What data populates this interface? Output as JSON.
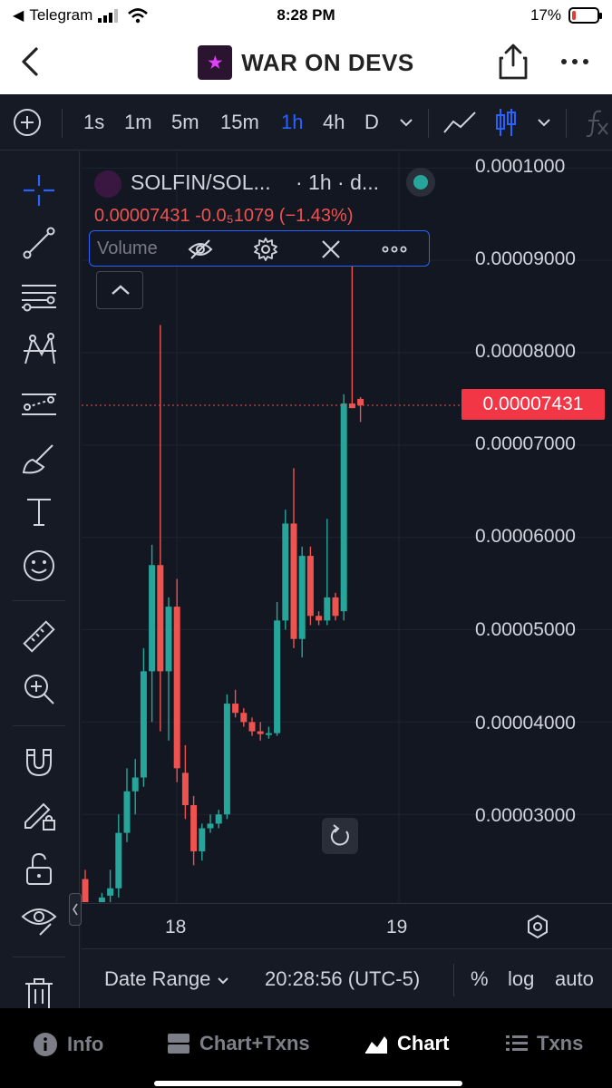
{
  "status_bar": {
    "carrier": "Telegram",
    "time": "8:28 PM",
    "battery": "17%",
    "battery_level": 0.17
  },
  "header": {
    "title": "WAR ON DEVS",
    "logo_icon": "fist-logo-icon"
  },
  "toolbar": {
    "timeframes": [
      "1s",
      "1m",
      "5m",
      "15m",
      "1h",
      "4h",
      "D"
    ],
    "active": "1h"
  },
  "legend": {
    "symbol": "SOLFIN/SOL...",
    "interval": "· 1h · d...",
    "price_info": "0.00007431  -0.0₅1079 (−1.43%)"
  },
  "indicator": {
    "label": "Volume"
  },
  "price_tag": "0.00007431",
  "axis": {
    "y_ticks": [
      "0.0001000",
      "0.00009000",
      "0.00008000",
      "0.00007000",
      "0.00006000",
      "0.00005000",
      "0.00004000",
      "0.00003000"
    ],
    "x_ticks": [
      "18",
      "19"
    ]
  },
  "bottom_bar": {
    "date_range": "Date Range",
    "clock": "20:28:56 (UTC-5)",
    "percent": "%",
    "log": "log",
    "auto": "auto"
  },
  "nav": [
    {
      "label": "Info",
      "icon": "info-icon"
    },
    {
      "label": "Chart+Txns",
      "icon": "split-icon"
    },
    {
      "label": "Chart",
      "icon": "chart-icon"
    },
    {
      "label": "Txns",
      "icon": "list-icon"
    }
  ],
  "colors": {
    "up": "#26a69a",
    "down": "#ef5350",
    "accent": "#2962ff"
  },
  "chart_data": {
    "type": "candlestick",
    "y_range": [
      2.05e-05,
      0.0001018
    ],
    "current_price": 7.431e-05,
    "candles": [
      {
        "o": 2.3e-05,
        "h": 2.4e-05,
        "l": 2e-05,
        "c": 2.05e-05
      },
      {
        "o": 2e-05,
        "h": 2.05e-05,
        "l": 1.95e-05,
        "c": 2.03e-05
      },
      {
        "o": 2e-05,
        "h": 2.15e-05,
        "l": 1.95e-05,
        "c": 2.1e-05
      },
      {
        "o": 2.12e-05,
        "h": 2.4e-05,
        "l": 2e-05,
        "c": 2.2e-05
      },
      {
        "o": 2.2e-05,
        "h": 3e-05,
        "l": 2.1e-05,
        "c": 2.8e-05
      },
      {
        "o": 2.8e-05,
        "h": 3.5e-05,
        "l": 2.7e-05,
        "c": 3.25e-05
      },
      {
        "o": 3.25e-05,
        "h": 3.6e-05,
        "l": 3e-05,
        "c": 3.4e-05
      },
      {
        "o": 3.4e-05,
        "h": 4.8e-05,
        "l": 3.3e-05,
        "c": 4.55e-05
      },
      {
        "o": 4.55e-05,
        "h": 5.92e-05,
        "l": 4e-05,
        "c": 5.7e-05
      },
      {
        "o": 5.7e-05,
        "h": 8.3e-05,
        "l": 3.9e-05,
        "c": 4.55e-05
      },
      {
        "o": 4.55e-05,
        "h": 5.35e-05,
        "l": 3.8e-05,
        "c": 5.25e-05
      },
      {
        "o": 5.25e-05,
        "h": 5.55e-05,
        "l": 3.35e-05,
        "c": 3.5e-05
      },
      {
        "o": 3.45e-05,
        "h": 3.75e-05,
        "l": 2.95e-05,
        "c": 3.1e-05
      },
      {
        "o": 3.1e-05,
        "h": 3.2e-05,
        "l": 2.45e-05,
        "c": 2.6e-05
      },
      {
        "o": 2.6e-05,
        "h": 2.9e-05,
        "l": 2.5e-05,
        "c": 2.85e-05
      },
      {
        "o": 2.85e-05,
        "h": 3e-05,
        "l": 2.8e-05,
        "c": 2.9e-05
      },
      {
        "o": 2.9e-05,
        "h": 3.05e-05,
        "l": 2.85e-05,
        "c": 3e-05
      },
      {
        "o": 3e-05,
        "h": 4.3e-05,
        "l": 2.95e-05,
        "c": 4.2e-05
      },
      {
        "o": 4.2e-05,
        "h": 4.35e-05,
        "l": 4.05e-05,
        "c": 4.1e-05
      },
      {
        "o": 4.1e-05,
        "h": 4.15e-05,
        "l": 3.95e-05,
        "c": 4e-05
      },
      {
        "o": 4e-05,
        "h": 4.05e-05,
        "l": 3.85e-05,
        "c": 3.9e-05
      },
      {
        "o": 3.9e-05,
        "h": 4e-05,
        "l": 3.8e-05,
        "c": 3.87e-05
      },
      {
        "o": 3.87e-05,
        "h": 3.95e-05,
        "l": 3.82e-05,
        "c": 3.88e-05
      },
      {
        "o": 3.88e-05,
        "h": 5.3e-05,
        "l": 3.85e-05,
        "c": 5.1e-05
      },
      {
        "o": 5.1e-05,
        "h": 6.3e-05,
        "l": 5e-05,
        "c": 6.15e-05
      },
      {
        "o": 6.15e-05,
        "h": 6.75e-05,
        "l": 4.8e-05,
        "c": 4.9e-05
      },
      {
        "o": 4.9e-05,
        "h": 5.9e-05,
        "l": 4.7e-05,
        "c": 5.8e-05
      },
      {
        "o": 5.8e-05,
        "h": 5.9e-05,
        "l": 5.05e-05,
        "c": 5.15e-05
      },
      {
        "o": 5.15e-05,
        "h": 5.2e-05,
        "l": 5.05e-05,
        "c": 5.1e-05
      },
      {
        "o": 5.1e-05,
        "h": 6.2e-05,
        "l": 5.05e-05,
        "c": 5.35e-05
      },
      {
        "o": 5.35e-05,
        "h": 5.4e-05,
        "l": 5.1e-05,
        "c": 5.15e-05
      },
      {
        "o": 5.2e-05,
        "h": 7.55e-05,
        "l": 5.1e-05,
        "c": 7.45e-05
      },
      {
        "o": 7.45e-05,
        "h": 9e-05,
        "l": 7.4e-05,
        "c": 7.4e-05
      },
      {
        "o": 7.5e-05,
        "h": 7.52e-05,
        "l": 7.25e-05,
        "c": 7.43e-05
      }
    ]
  }
}
